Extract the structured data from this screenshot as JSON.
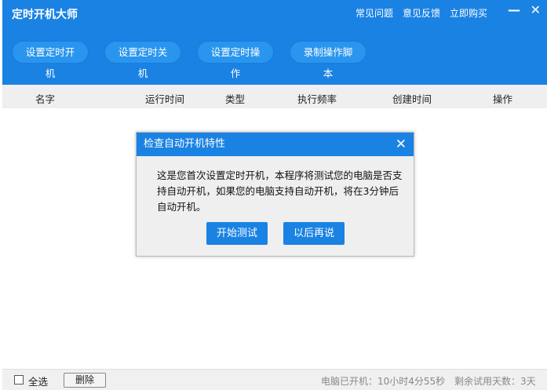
{
  "app": {
    "title": "定时开机大师",
    "links": [
      "常见问题",
      "意见反馈",
      "立即购买"
    ],
    "minimize": "—",
    "close": "✕"
  },
  "toolbar": [
    "设置定时开机",
    "设置定时关机",
    "设置定时操作",
    "录制操作脚本"
  ],
  "table": {
    "columns": [
      "名字",
      "运行时间",
      "类型",
      "执行频率",
      "创建时间",
      "操作"
    ]
  },
  "footer": {
    "select_all": "全选",
    "delete": "删除",
    "uptime": "电脑已开机：10小时4分55秒",
    "trial": "剩余试用天数：3天"
  },
  "dialog": {
    "title": "检查自动开机特性",
    "close": "✕",
    "lines": [
      "这是您首次设置定时开机，本程序将测试您的电脑是否支",
      "持自动开机，如果您的电脑支持自动开机，将在3分钟后",
      "自动开机。"
    ],
    "start": "开始测试",
    "later": "以后再说"
  }
}
